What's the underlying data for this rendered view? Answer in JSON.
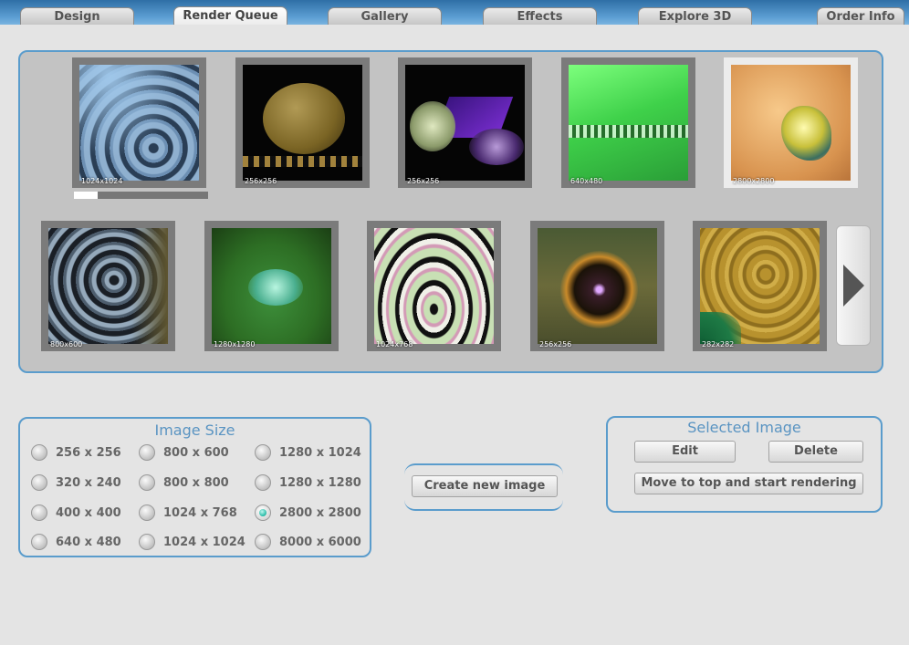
{
  "tabs": [
    {
      "label": "Design",
      "active": false
    },
    {
      "label": "Render Queue",
      "active": true
    },
    {
      "label": "Gallery",
      "active": false
    },
    {
      "label": "Effects",
      "active": false
    },
    {
      "label": "Explore 3D",
      "active": false
    },
    {
      "label": "Order Info",
      "active": false
    }
  ],
  "queue": {
    "rendering_progress": 0.18,
    "thumbnails": [
      {
        "size": "1024x1024",
        "selected": false
      },
      {
        "size": "256x256",
        "selected": false
      },
      {
        "size": "256x256",
        "selected": false
      },
      {
        "size": "640x480",
        "selected": false
      },
      {
        "size": "2800x2800",
        "selected": true
      },
      {
        "size": "800x600",
        "selected": false
      },
      {
        "size": "1280x1280",
        "selected": false
      },
      {
        "size": "1024x768",
        "selected": false
      },
      {
        "size": "256x256",
        "selected": false
      },
      {
        "size": "282x282",
        "selected": false
      }
    ],
    "next_icon": "triangle-right-icon"
  },
  "image_size": {
    "title": "Image Size",
    "options": [
      {
        "label": "256 x 256",
        "checked": false
      },
      {
        "label": "320 x 240",
        "checked": false
      },
      {
        "label": "400 x 400",
        "checked": false
      },
      {
        "label": "640 x 480",
        "checked": false
      },
      {
        "label": "800 x 600",
        "checked": false
      },
      {
        "label": "800 x 800",
        "checked": false
      },
      {
        "label": "1024 x 768",
        "checked": false
      },
      {
        "label": "1024 x 1024",
        "checked": false
      },
      {
        "label": "1280 x 1024",
        "checked": false
      },
      {
        "label": "1280 x 1280",
        "checked": false
      },
      {
        "label": "2800 x 2800",
        "checked": true
      },
      {
        "label": "8000 x 6000",
        "checked": false
      }
    ]
  },
  "create_button": "Create new image",
  "selected_image": {
    "title": "Selected Image",
    "edit": "Edit",
    "delete": "Delete",
    "move": "Move to top and start rendering"
  },
  "colors": {
    "accent": "#5a9ccc",
    "tabbar": "#4a8cc4",
    "radio_checked": "#22b9a4"
  }
}
